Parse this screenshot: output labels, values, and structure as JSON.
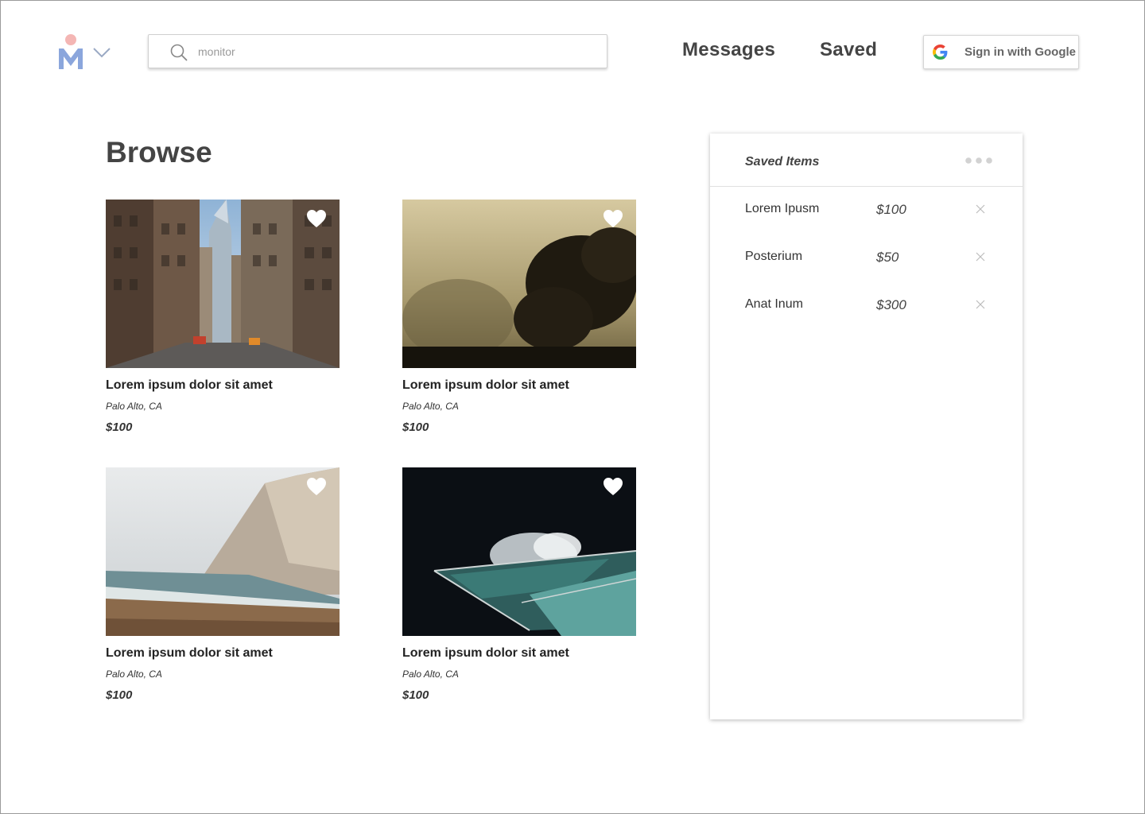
{
  "header": {
    "search_placeholder": "monitor",
    "nav": {
      "messages": "Messages",
      "saved": "Saved"
    },
    "google_button": "Sign in with Google"
  },
  "browse": {
    "title": "Browse",
    "cards": [
      {
        "title": "Lorem ipsum dolor sit amet",
        "location": "Palo Alto, CA",
        "price": "$100",
        "image": "city-street"
      },
      {
        "title": "Lorem ipsum dolor sit amet",
        "location": "Palo Alto, CA",
        "price": "$100",
        "image": "foggy-trees"
      },
      {
        "title": "Lorem ipsum dolor sit amet",
        "location": "Palo Alto, CA",
        "price": "$100",
        "image": "cliff-beach"
      },
      {
        "title": "Lorem ipsum dolor sit amet",
        "location": "Palo Alto, CA",
        "price": "$100",
        "image": "ocean-pool"
      }
    ]
  },
  "saved_panel": {
    "title": "Saved Items",
    "items": [
      {
        "name": "Lorem Ipusm",
        "price": "$100"
      },
      {
        "name": "Posterium",
        "price": "$50"
      },
      {
        "name": "Anat Inum",
        "price": "$300"
      }
    ]
  },
  "icons": {
    "logo": "person-m-logo-icon",
    "dropdown": "chevron-down-icon",
    "search": "search-icon",
    "google": "google-g-icon",
    "favorite": "heart-icon",
    "menu": "more-dots-icon",
    "remove": "close-icon"
  },
  "colors": {
    "logo_head": "#f4b6b4",
    "logo_body": "#8ba6dc",
    "text_dark": "#444444",
    "heart": "#ffffff"
  }
}
